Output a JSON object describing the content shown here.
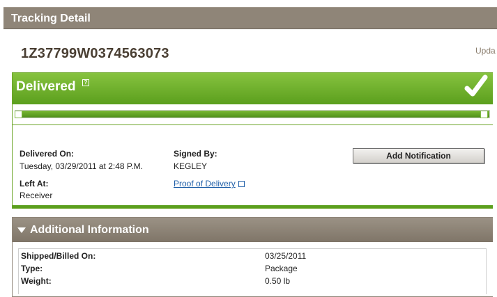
{
  "header": {
    "title": "Tracking Detail"
  },
  "tracking": {
    "number": "1Z37799W0374563073",
    "updated_text": "Upda"
  },
  "status": {
    "label": "Delivered",
    "help_icon": "help-icon",
    "check_icon": "check-icon",
    "progress_percent": 100,
    "delivered_on_label": "Delivered On:",
    "delivered_on_value": "Tuesday,  03/29/2011 at 2:48 P.M.",
    "signed_by_label": "Signed By:",
    "signed_by_value": "KEGLEY",
    "left_at_label": "Left At:",
    "left_at_value": "Receiver",
    "proof_link": "Proof of Delivery",
    "add_notification_label": "Add Notification"
  },
  "additional": {
    "title": "Additional Information",
    "rows": [
      {
        "label": "Shipped/Billed On:",
        "value": "03/25/2011"
      },
      {
        "label": "Type:",
        "value": "Package"
      },
      {
        "label": "Weight:",
        "value": "0.50 lb"
      }
    ]
  },
  "colors": {
    "green": "#5b9f1d",
    "taupe": "#8f8578",
    "link": "#1f5fa8"
  }
}
